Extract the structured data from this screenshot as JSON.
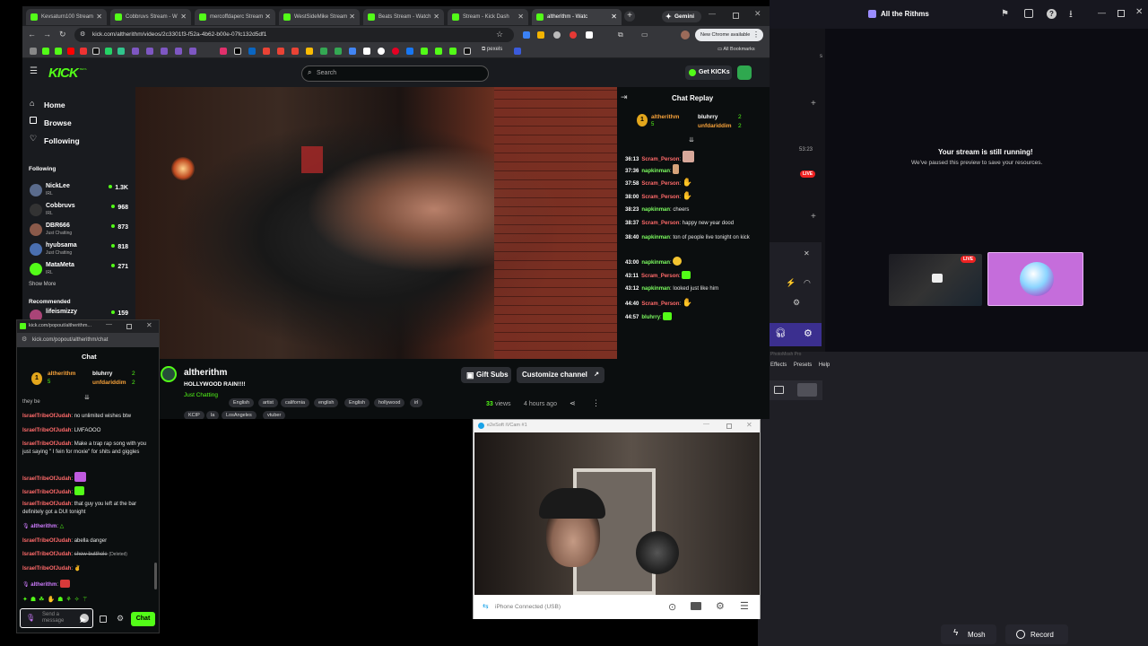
{
  "browser": {
    "tabs": [
      {
        "label": "Kevsaturn100 Stream"
      },
      {
        "label": "Cobbruvs Stream - W"
      },
      {
        "label": "mercoffdaperc Stream"
      },
      {
        "label": "WestSideMike Stream"
      },
      {
        "label": "Beats Stream - Watch"
      },
      {
        "label": "Stream - Kick Dash"
      },
      {
        "label": "altherithm - Watc"
      }
    ],
    "gemini_label": "Gemini",
    "url": "kick.com/altherithm/videos/2c3301f3-f52a-4b62-b00e-07fc132d5df1",
    "update_label": "New Chrome available",
    "bookmarks_pexels": "pexels",
    "all_bookmarks": "All Bookmarks"
  },
  "kick": {
    "logo": "KICK",
    "logo_sub": "BETA",
    "search_placeholder": "Search",
    "get_kicks": "Get KICKs",
    "nav": {
      "home": "Home",
      "browse": "Browse",
      "following": "Following"
    },
    "following_header": "Following",
    "following": [
      {
        "name": "NickLee",
        "category": "IRL",
        "viewers": "1.3K"
      },
      {
        "name": "Cobbruvs",
        "category": "IRL",
        "viewers": "968"
      },
      {
        "name": "DBR666",
        "category": "Just Chatting",
        "viewers": "873"
      },
      {
        "name": "hyubsama",
        "category": "Just Chatting",
        "viewers": "818"
      },
      {
        "name": "MataMeta",
        "category": "IRL",
        "viewers": "271"
      }
    ],
    "show_more": "Show More",
    "recommended_header": "Recommended",
    "recommended": [
      {
        "name": "lifeismizzy",
        "viewers": "159"
      }
    ],
    "video": {
      "channel": "altherithm",
      "title": "HOLLYWOOD RAIN!!!!",
      "category": "Just Chatting",
      "tags": [
        "English",
        "artist",
        "california",
        "english",
        "English",
        "hollywood",
        "irl",
        "KCIP",
        "la",
        "LosAngeles",
        "vtuber"
      ],
      "views": "33",
      "views_label": "views",
      "ago": "4 hours ago",
      "gift_subs": "Gift Subs",
      "customize": "Customize channel"
    },
    "chat_replay": {
      "title": "Chat Replay",
      "gifters": [
        {
          "rank": "1",
          "name": "altherithm",
          "count": "5"
        },
        {
          "name": "bluhrry",
          "count": "2"
        },
        {
          "name": "unfdariddim",
          "count": "2"
        }
      ],
      "messages": [
        {
          "time": "36:13",
          "user": "Scram_Person",
          "text": ""
        },
        {
          "time": "37:36",
          "user": "napkinman",
          "text": ""
        },
        {
          "time": "37:58",
          "user": "Scram_Person",
          "text": ""
        },
        {
          "time": "38:00",
          "user": "Scram_Person",
          "text": ""
        },
        {
          "time": "38:23",
          "user": "napkinman",
          "text": "cheers"
        },
        {
          "time": "38:37",
          "user": "Scram_Person",
          "text": "happy new year dood"
        },
        {
          "time": "38:40",
          "user": "napkinman",
          "text": "ton of people live tonight on kick"
        },
        {
          "time": "43:00",
          "user": "napkinman",
          "text": ""
        },
        {
          "time": "43:11",
          "user": "Scram_Person",
          "text": ""
        },
        {
          "time": "43:12",
          "user": "napkinman",
          "text": "looked just like him"
        },
        {
          "time": "44:40",
          "user": "Scram_Person",
          "text": ""
        },
        {
          "time": "44:57",
          "user": "bluhrry",
          "text": ""
        }
      ]
    }
  },
  "popout": {
    "window_title": "kick.com/popout/altherithm...",
    "url": "kick.com/popout/altherithm/chat",
    "title": "Chat",
    "gifters": [
      {
        "rank": "1",
        "name": "altherithm",
        "count": "5"
      },
      {
        "name": "bluhrry",
        "count": "2"
      },
      {
        "name": "unfdariddim",
        "count": "2"
      }
    ],
    "clip_top": "they be",
    "messages": [
      {
        "user": "IsraelTribeOfJudah",
        "text": "no unlimited wishes btw"
      },
      {
        "user": "IsraelTribeOfJudah",
        "text": "LMFAOOO"
      },
      {
        "user": "IsraelTribeOfJudah",
        "text": "Make a trap rap song with you just saying \" I fein for moxie\" for shits and giggles"
      },
      {
        "user": "IsraelTribeOfJudah",
        "text": ""
      },
      {
        "user": "IsraelTribeOfJudah",
        "text": ""
      },
      {
        "user": "IsraelTribeOfJudah",
        "text": "that guy you left at the bar definitely got a DUI tonight"
      },
      {
        "user": "altherithm",
        "text": ""
      },
      {
        "user": "IsraelTribeOfJudah",
        "text": "abella danger"
      },
      {
        "user": "IsraelTribeOfJudah",
        "text": "show butthole",
        "deleted": "(Deleted)"
      },
      {
        "user": "IsraelTribeOfJudah",
        "text": ""
      },
      {
        "user": "altherithm",
        "text": ""
      }
    ],
    "input_placeholder": "Send a message",
    "chat_button": "Chat"
  },
  "studio": {
    "title": "All the Rithms",
    "running_title": "Your stream is still running!",
    "running_sub": "We've paused this preview to save your resources.",
    "live_badge": "LIVE",
    "time": "53:23",
    "side_label": "s"
  },
  "webcam": {
    "title": "e2eSoft iVCam #1",
    "status": "iPhone Connected (USB)"
  },
  "photomosh": {
    "app": "PhotoMosh Pro",
    "menu": [
      "Effects",
      "Presets",
      "Help"
    ],
    "mosh": "Mosh",
    "record": "Record"
  },
  "colors": {
    "kick_green": "#53fc18",
    "chrome_dark": "#202124",
    "kick_bg": "#0b0e0f"
  }
}
